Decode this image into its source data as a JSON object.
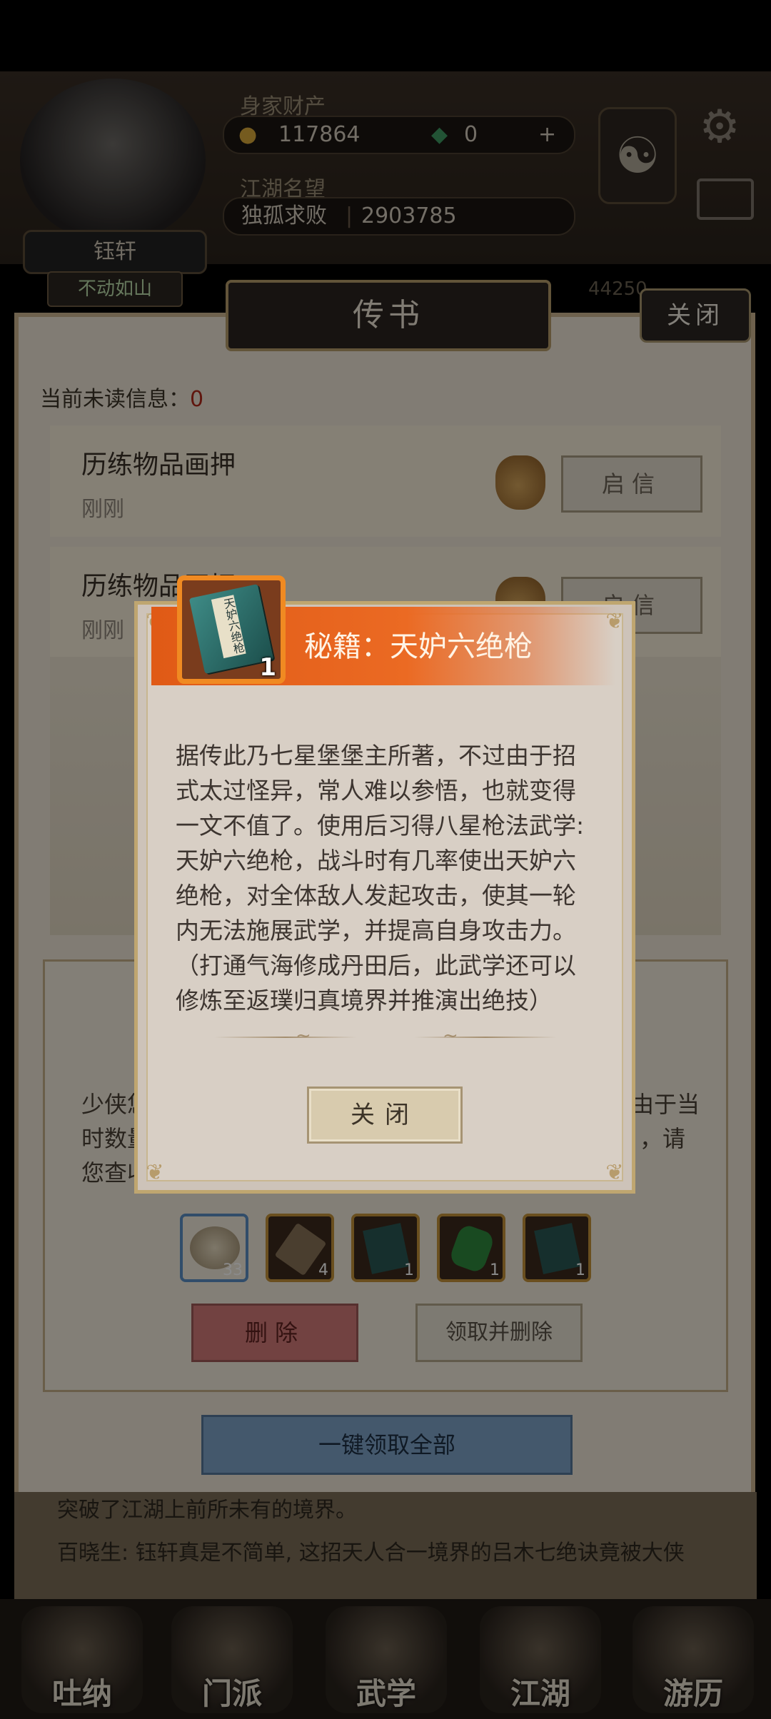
{
  "hud": {
    "player_name": "钰轩",
    "immobile_button": "不动如山",
    "assets_label": "身家财产",
    "gold": "117864",
    "jade": "0",
    "add_symbol": "+",
    "reputation_label": "江湖名望",
    "rank_title": "独孤求败",
    "reputation_value": "2903785",
    "side_value": "44250"
  },
  "letter_panel": {
    "title": "传书",
    "close_label": "关闭",
    "unread_label": "当前未读信息：",
    "unread_count": "0",
    "mails": [
      {
        "title": "历练物品画押",
        "time": "刚刚",
        "open_label": "启信"
      },
      {
        "title": "历练物品画押",
        "time": "刚刚",
        "open_label": "启信"
      }
    ],
    "detail_text_line1": "少侠您好，由于当",
    "detail_text_line2": "时数量，请",
    "detail_text_line3": "您查收",
    "attachments": [
      {
        "icon": "pill-icon",
        "count": "33",
        "color": "#3c6fa6"
      },
      {
        "icon": "scroll-icon",
        "count": "4",
        "color": "#5b4a3a"
      },
      {
        "icon": "book-icon",
        "count": "1",
        "color": "#2a5854"
      },
      {
        "icon": "jade-icon",
        "count": "1",
        "color": "#2f8a3e"
      },
      {
        "icon": "book-icon",
        "count": "1",
        "color": "#2a5854"
      }
    ],
    "delete_label": "删除",
    "claim_delete_label": "领取并删除",
    "claim_all_label": "一键领取全部"
  },
  "chat": {
    "line1": "突破了江湖上前所未有的境界。",
    "line2": "百晓生: 钰轩真是不简单, 这招天人合一境界的吕木七绝诀竟被大侠"
  },
  "navbar": {
    "items": [
      "吐纳",
      "门派",
      "武学",
      "江湖",
      "游历"
    ]
  },
  "popup": {
    "item_name": "秘籍：天妒六绝枪",
    "item_count": "1",
    "book_cover_text": "天妒六绝枪",
    "description": "据传此乃七星堡堡主所著，不过由于招式太过怪异，常人难以参悟，也就变得一文不值了。使用后习得八星枪法武学:天妒六绝枪，战斗时有几率使出天妒六绝枪，对全体敌人发起攻击，使其一轮内无法施展武学，并提高自身攻击力。（打通气海修成丹田后，此武学还可以修炼至返璞归真境界并推演出绝技）",
    "close_label": "关闭",
    "accent_color": "#e35f1c"
  }
}
